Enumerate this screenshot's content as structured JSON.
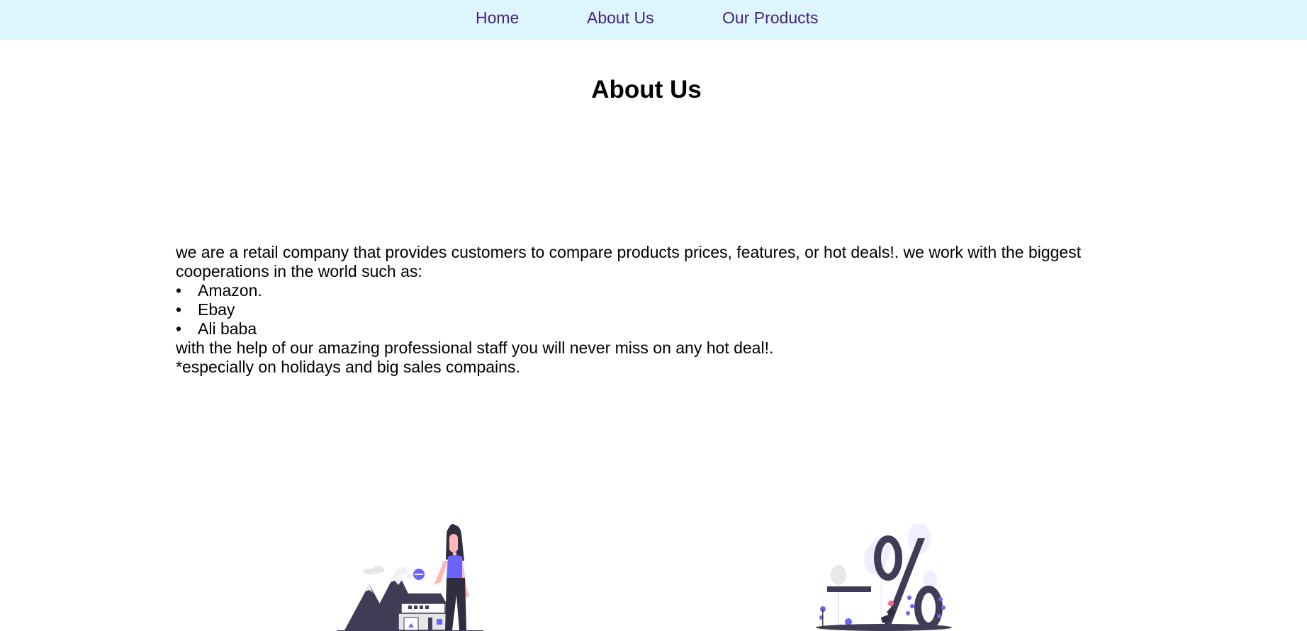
{
  "nav": {
    "items": [
      {
        "label": "Home"
      },
      {
        "label": "About Us"
      },
      {
        "label": "Our Products"
      }
    ]
  },
  "main": {
    "title": "About Us",
    "intro": "we are a retail company that provides customers to compare products prices, features, or hot deals!. we work with the biggest cooperations in the world such as:",
    "partners": [
      "Amazon.",
      "Ebay",
      "Ali baba"
    ],
    "outro_1": "with the help of our amazing professional staff you will never miss on any hot deal!.",
    "outro_2": "*especially on holidays and big sales compains."
  },
  "illustrations": [
    {
      "icon": "woman-with-house-and-mountains-illustration"
    },
    {
      "icon": "percent-sale-illustration"
    }
  ],
  "colors": {
    "nav_background": "#ddf5fd",
    "nav_link": "#46237a",
    "illustration_dark": "#3f3d56",
    "illustration_accent": "#6c63ff",
    "skin": "#ffb8b8"
  }
}
